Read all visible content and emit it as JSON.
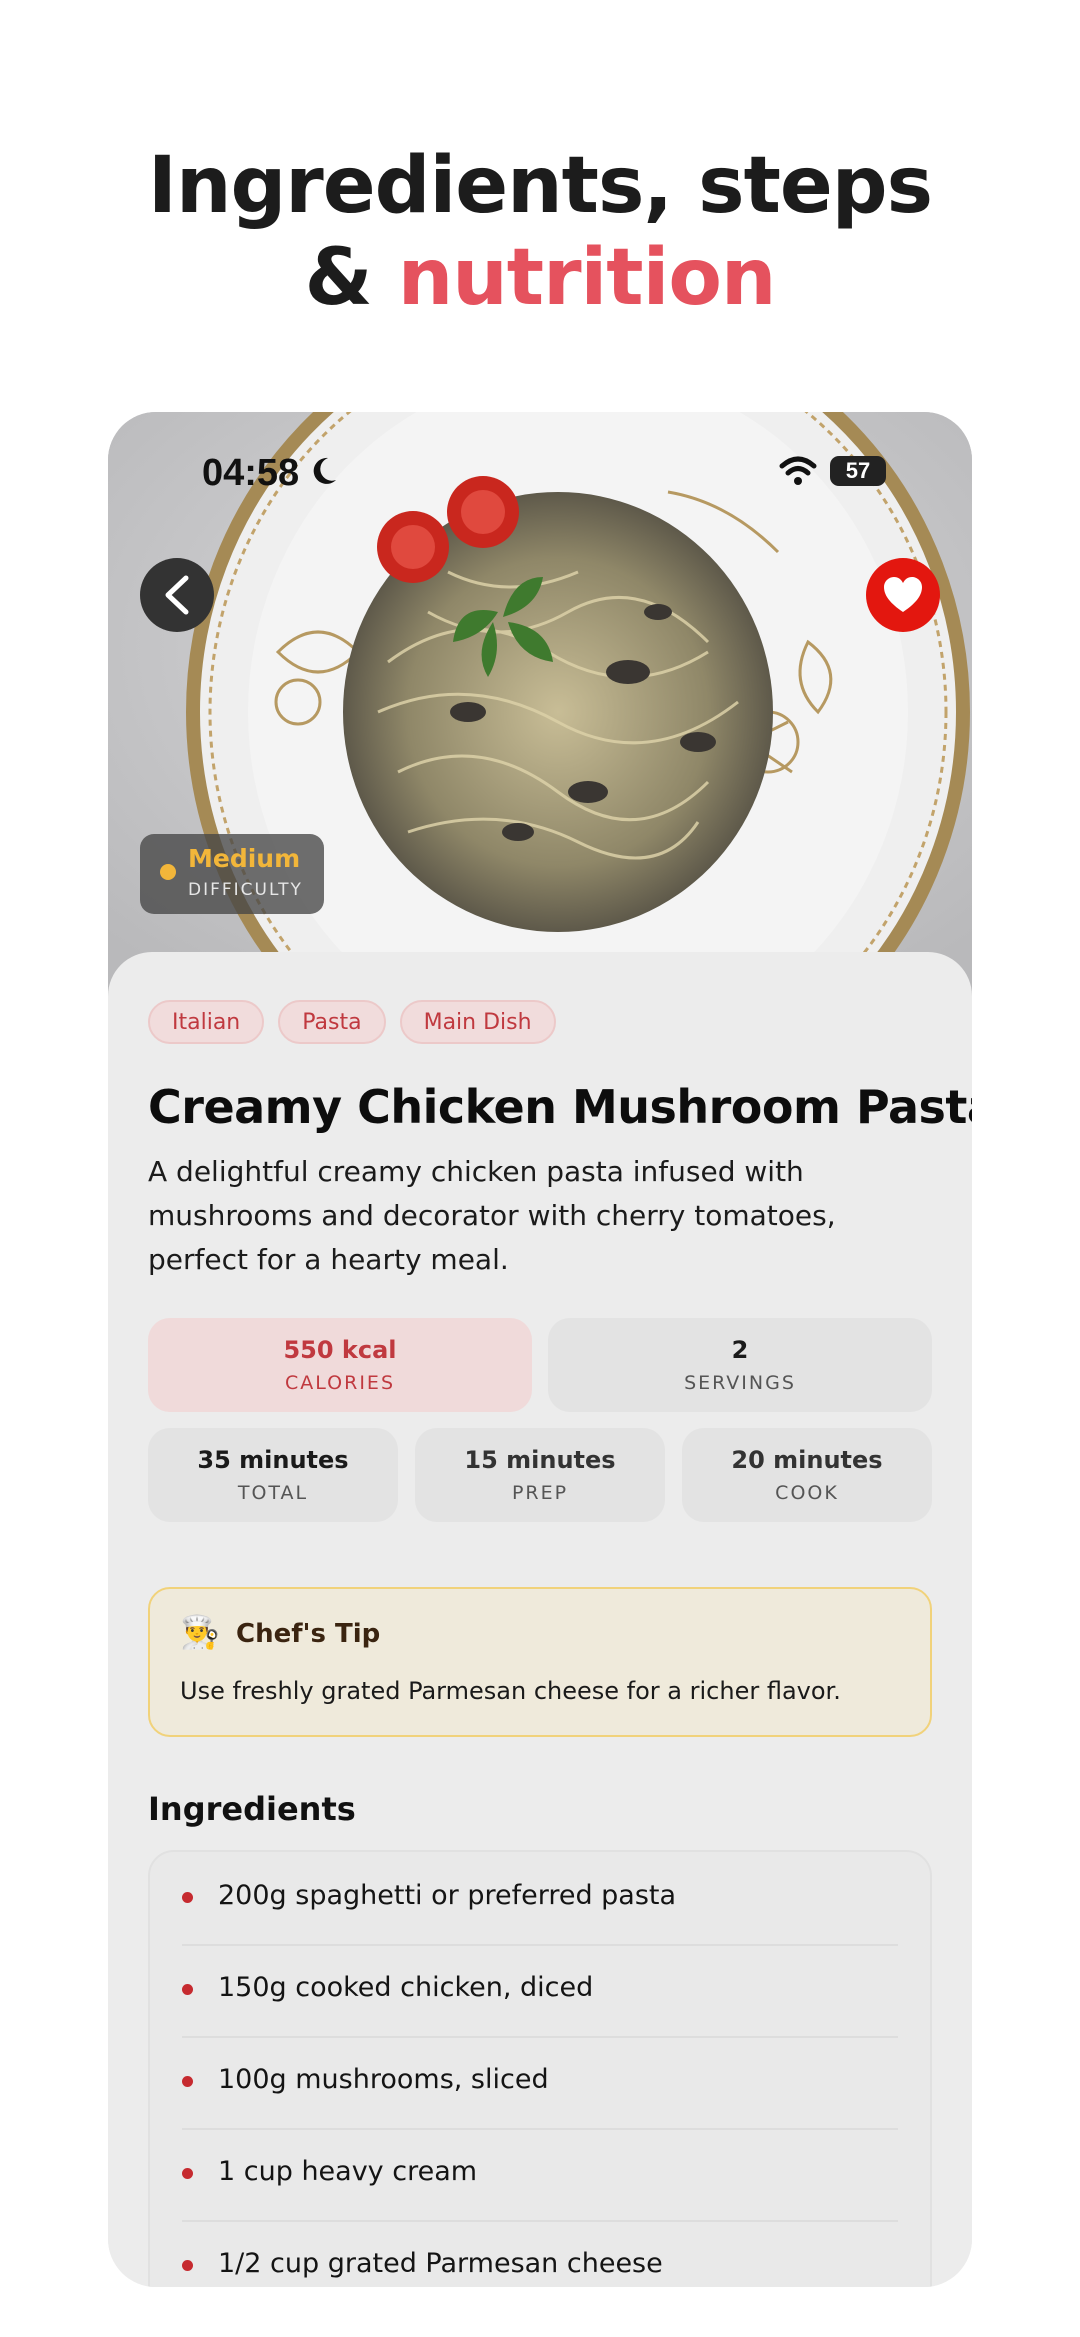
{
  "headline": {
    "line1": "Ingredients, steps",
    "line2_prefix": "& ",
    "line2_accent": "nutrition"
  },
  "status_bar": {
    "time": "04:58",
    "battery": "57"
  },
  "hero": {
    "difficulty_level": "Medium",
    "difficulty_label": "DIFFICULTY"
  },
  "recipe": {
    "tags": [
      "Italian",
      "Pasta",
      "Main Dish"
    ],
    "title": "Creamy Chicken Mushroom Pasta",
    "description": "A delightful creamy chicken pasta infused with mushrooms and decorator with cherry tomatoes, perfect for a hearty meal.",
    "stats": {
      "calories": {
        "value": "550 kcal",
        "label": "CALORIES"
      },
      "servings": {
        "value": "2",
        "label": "SERVINGS"
      },
      "total": {
        "value": "35 minutes",
        "label": "TOTAL"
      },
      "prep": {
        "value": "15 minutes",
        "label": "PREP"
      },
      "cook": {
        "value": "20 minutes",
        "label": "COOK"
      }
    },
    "chef_tip": {
      "icon": "👨‍🍳",
      "title": "Chef's Tip",
      "body": "Use freshly grated Parmesan cheese for a richer flavor."
    },
    "ingredients_title": "Ingredients",
    "ingredients": [
      "200g spaghetti or preferred pasta",
      "150g cooked chicken, diced",
      "100g mushrooms, sliced",
      "1 cup heavy cream",
      "1/2 cup grated Parmesan cheese"
    ]
  },
  "colors": {
    "accent": "#e5525e",
    "favorite": "#e3170f",
    "difficulty": "#f2b63a",
    "tag_text": "#c0393f"
  },
  "icons": {
    "back": "chevron-left-icon",
    "favorite": "heart-icon",
    "moon": "moon-icon",
    "wifi": "wifi-icon"
  }
}
